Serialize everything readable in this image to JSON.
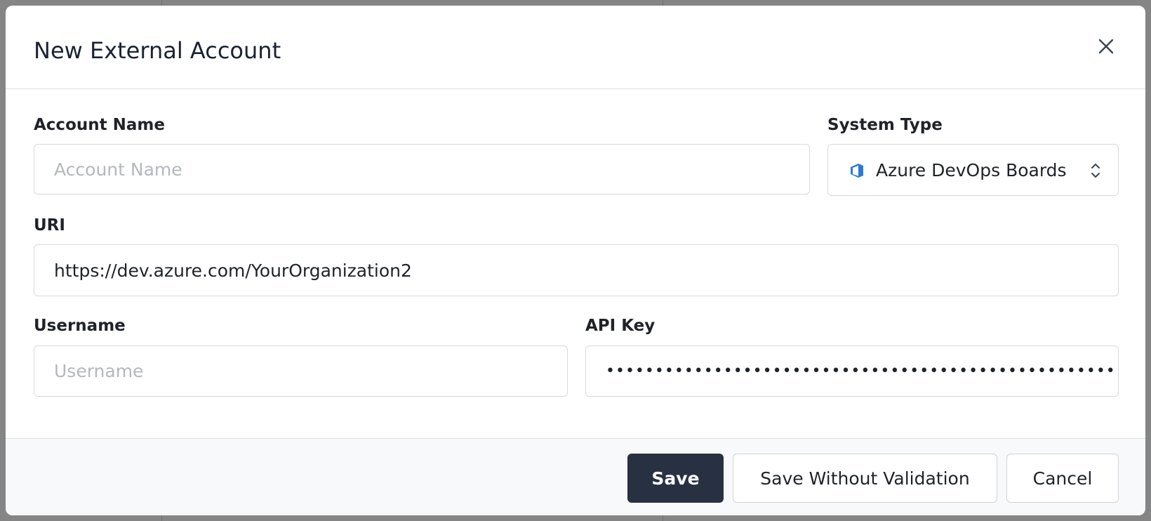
{
  "dialog": {
    "title": "New External Account"
  },
  "form": {
    "account_name": {
      "label": "Account Name",
      "value": "",
      "placeholder": "Account Name"
    },
    "system_type": {
      "label": "System Type",
      "value": "Azure DevOps Boards",
      "icon": "azure-devops-icon"
    },
    "uri": {
      "label": "URI",
      "value": "https://dev.azure.com/YourOrganization2",
      "placeholder": ""
    },
    "username": {
      "label": "Username",
      "value": "",
      "placeholder": "Username"
    },
    "api_key": {
      "label": "API Key",
      "value": "••••••••••••••••••••••••••••••••••••••••••••••••••••••"
    }
  },
  "footer": {
    "save_label": "Save",
    "save_without_validation_label": "Save Without Validation",
    "cancel_label": "Cancel"
  },
  "colors": {
    "primary_button": "#283142",
    "azure_icon": "#2b7bd3"
  }
}
